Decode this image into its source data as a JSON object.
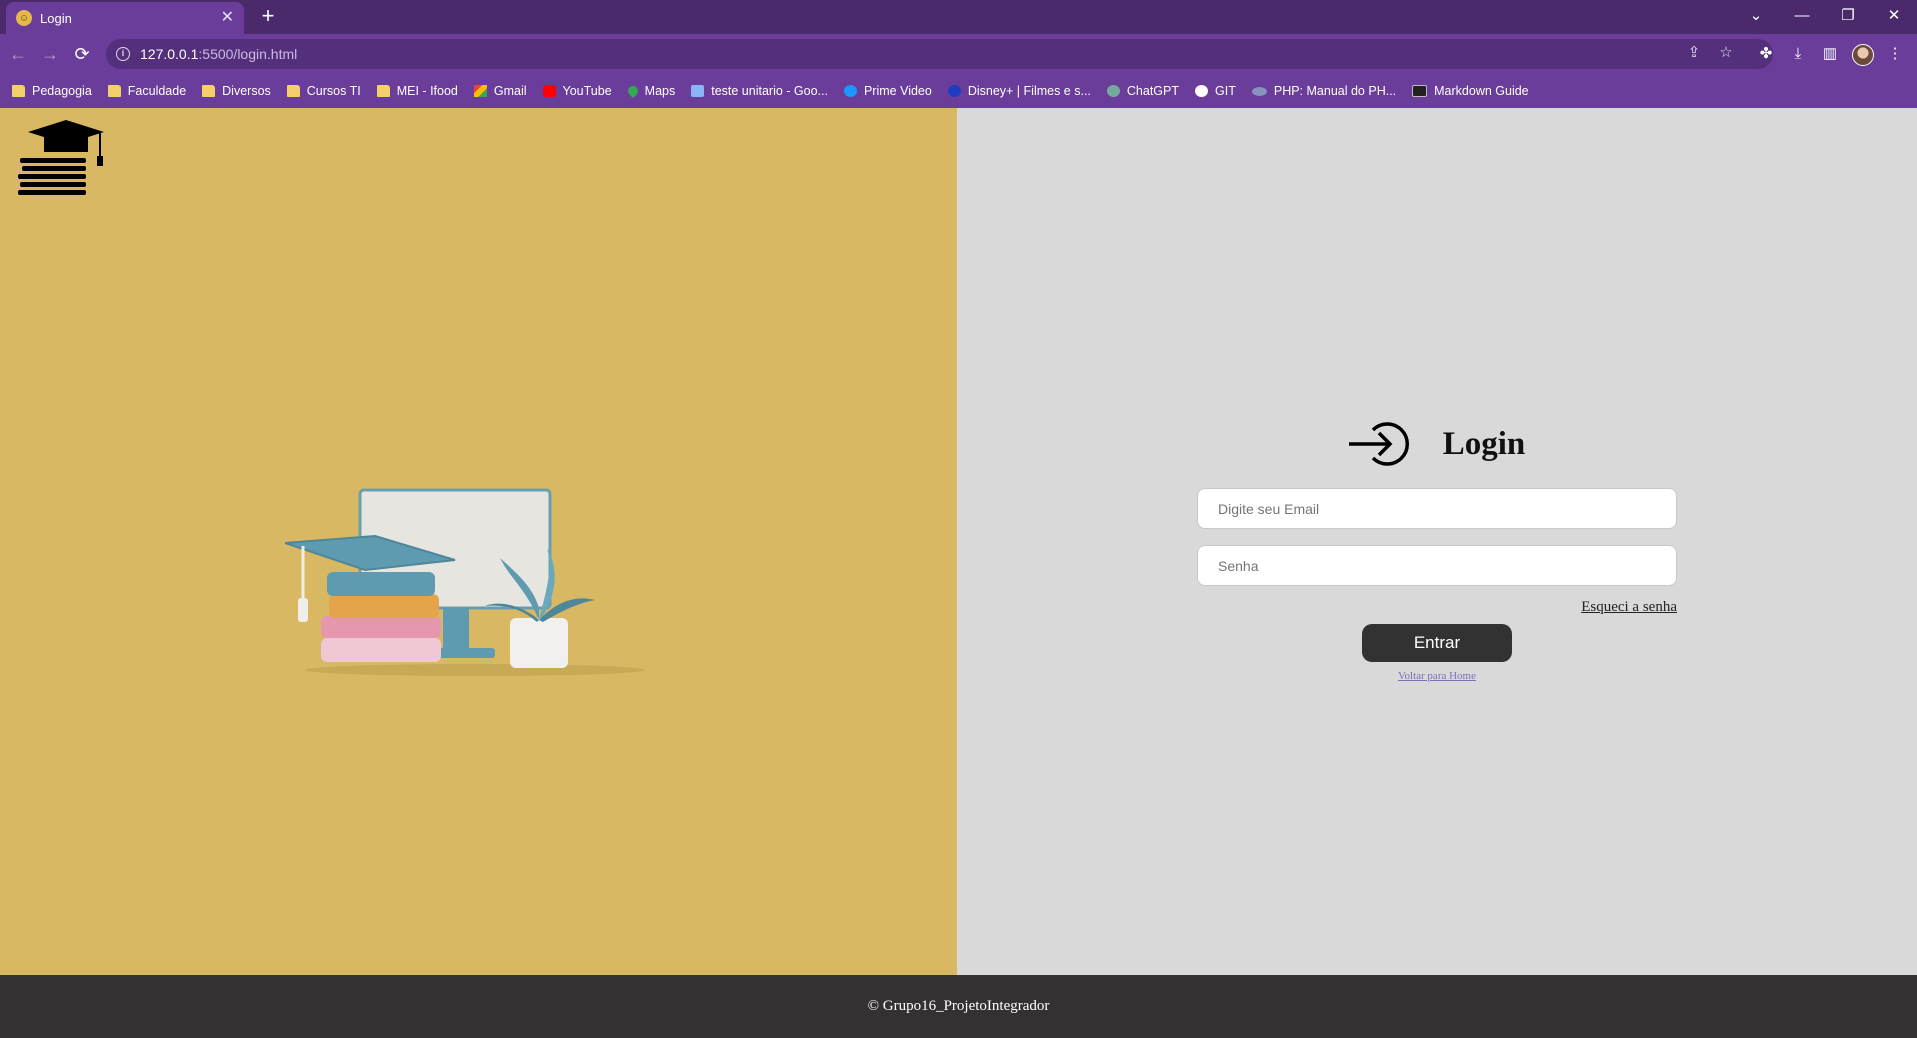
{
  "browser": {
    "tab_title": "Login",
    "tab_close": "✕",
    "new_tab": "+",
    "url_host": "127.0.0.1",
    "url_path": ":5500/login.html",
    "window_controls": [
      "⌄",
      "—",
      "❐",
      "✕"
    ],
    "nav": {
      "back": "←",
      "forward": "→",
      "reload": "⟳"
    },
    "bookmarks": [
      {
        "label": "Pedagogia",
        "icon": "folder"
      },
      {
        "label": "Faculdade",
        "icon": "folder"
      },
      {
        "label": "Diversos",
        "icon": "folder"
      },
      {
        "label": "Cursos TI",
        "icon": "folder"
      },
      {
        "label": "MEI - Ifood",
        "icon": "folder"
      },
      {
        "label": "Gmail",
        "icon": "gmail"
      },
      {
        "label": "YouTube",
        "icon": "yt"
      },
      {
        "label": "Maps",
        "icon": "maps"
      },
      {
        "label": "teste unitario - Goo...",
        "icon": "gcloud"
      },
      {
        "label": "Prime Video",
        "icon": "prime"
      },
      {
        "label": "Disney+ | Filmes e s...",
        "icon": "disney"
      },
      {
        "label": "ChatGPT",
        "icon": "gpt"
      },
      {
        "label": "GIT",
        "icon": "git"
      },
      {
        "label": "PHP: Manual do PH...",
        "icon": "php"
      },
      {
        "label": "Markdown Guide",
        "icon": "md"
      }
    ],
    "accent_color": "#6a3d9a"
  },
  "page": {
    "login_title": "Login",
    "email_placeholder": "Digite seu Email",
    "password_placeholder": "Senha",
    "forgot_password": "Esqueci a senha",
    "submit_label": "Entrar",
    "back_home": "Voltar para Home",
    "footer": "© Grupo16_ProjetoIntegrador",
    "left_bg": "#d8b862",
    "right_bg": "#d9d9d9",
    "button_color": "#333232"
  }
}
